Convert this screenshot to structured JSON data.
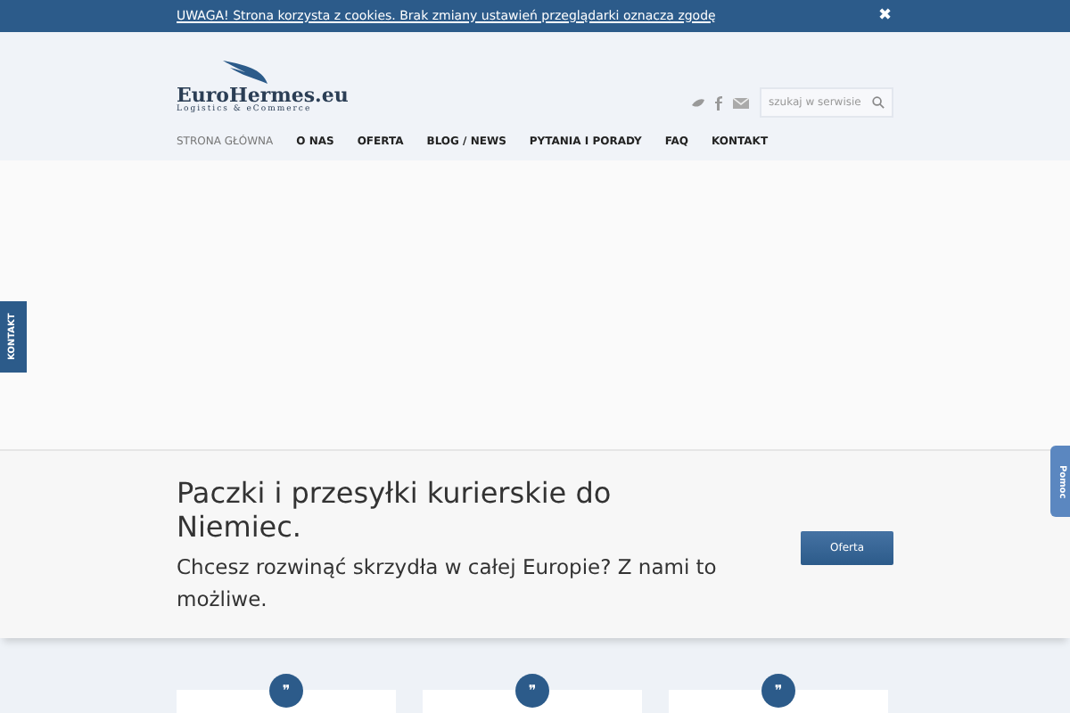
{
  "cookie_bar": {
    "text": "UWAGA! Strona korzysta z cookies. Brak zmiany ustawień przeglądarki oznacza zgodę",
    "close": "✖"
  },
  "logo": {
    "name": "EuroHermes.eu",
    "tagline": "Logistics & eCommerce"
  },
  "search": {
    "placeholder": "szukaj w serwisie"
  },
  "nav": [
    {
      "label": "STRONA GŁÓWNA",
      "selected": true
    },
    {
      "label": "O NAS",
      "selected": false
    },
    {
      "label": "OFERTA",
      "selected": false
    },
    {
      "label": "BLOG / NEWS",
      "selected": false
    },
    {
      "label": "PYTANIA I PORADY",
      "selected": false
    },
    {
      "label": "FAQ",
      "selected": false
    },
    {
      "label": "KONTAKT",
      "selected": false
    }
  ],
  "side_tabs": {
    "left": "KONTAKT",
    "right": "Pomoc"
  },
  "callout": {
    "title": "Paczki i przesyłki kurierskie do Niemiec.",
    "subtitle": "Chcesz rozwinąć skrzydła w całej Europie? Z nami to możliwe.",
    "button": "Oferta"
  },
  "testimonials": [
    {
      "quote_mark": "❞"
    },
    {
      "quote_mark": "❞"
    },
    {
      "quote_mark": "❞"
    }
  ]
}
